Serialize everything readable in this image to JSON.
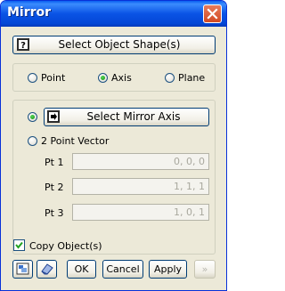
{
  "window": {
    "title": "Mirror"
  },
  "select_object_button": {
    "label": "Select Object Shape(s)"
  },
  "mirror_type": {
    "options": [
      {
        "label": "Point",
        "selected": false
      },
      {
        "label": "Axis",
        "selected": true
      },
      {
        "label": "Plane",
        "selected": false
      }
    ]
  },
  "mirror_axis": {
    "select_button_label": "Select Mirror Axis",
    "two_point_label": "2 Point Vector",
    "selected_mode": "axis",
    "points": [
      {
        "label": "Pt 1",
        "value": "0, 0, 0"
      },
      {
        "label": "Pt 2",
        "value": "1, 1, 1"
      },
      {
        "label": "Pt 3",
        "value": "1, 0, 1"
      }
    ]
  },
  "copy_objects": {
    "label": "Copy Object(s)",
    "checked": true
  },
  "footer": {
    "ok_label": "OK",
    "cancel_label": "Cancel",
    "apply_label": "Apply",
    "more_label": "»"
  },
  "icons": {
    "close": "close-icon",
    "question": "question-icon",
    "pick": "pick-arrow-icon",
    "preview": "preview-icon",
    "eraser": "eraser-icon"
  }
}
